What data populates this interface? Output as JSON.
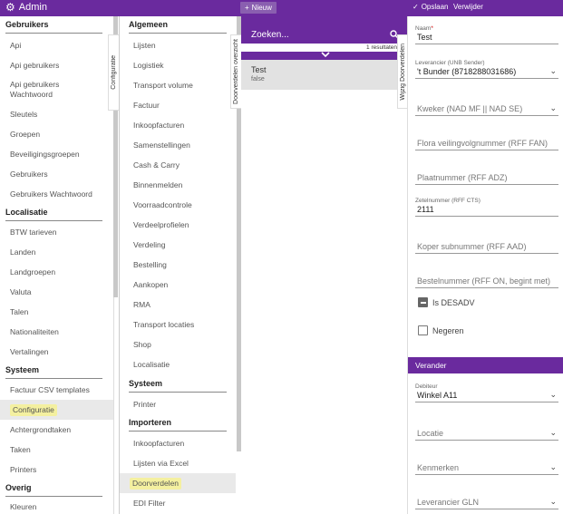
{
  "topbar": {
    "app_title": "Admin",
    "new_label": "Nieuw",
    "save_label": "Opslaan",
    "delete_label": "Verwijder",
    "icons": [
      "gear-icon",
      "plus-icon",
      "check-icon"
    ]
  },
  "nav1": {
    "sections": [
      {
        "title": "Gebruikers",
        "items": [
          "Api",
          "Api gebruikers",
          "Api gebruikers Wachtwoord",
          "Sleutels",
          "Groepen",
          "Beveiligingsgroepen",
          "Gebruikers",
          "Gebruikers Wachtwoord"
        ]
      },
      {
        "title": "Localisatie",
        "items": [
          "BTW tarieven",
          "Landen",
          "Landgroepen",
          "Valuta",
          "Talen",
          "Nationaliteiten",
          "Vertalingen"
        ]
      },
      {
        "title": "Systeem",
        "items": [
          "Factuur CSV templates",
          "Configuratie",
          "Achtergrondtaken",
          "Taken",
          "Printers"
        ]
      },
      {
        "title": "Overig",
        "items": [
          "Kleuren"
        ]
      }
    ],
    "active": "Configuratie"
  },
  "tabs": {
    "configuratie": "Configuratie",
    "doorverdelen_overzicht": "Doorverdelen overzicht",
    "wijzig_doorverdelen": "Wijzig Doorverdelen"
  },
  "nav2": {
    "sections": [
      {
        "title": "Algemeen",
        "items": [
          "Lijsten",
          "Logistiek",
          "Transport volume",
          "Factuur",
          "Inkoopfacturen",
          "Samenstellingen",
          "Cash & Carry",
          "Binnenmelden",
          "Voorraadcontrole",
          "Verdeelprofielen",
          "Verdeling",
          "Bestelling",
          "Aankopen",
          "RMA",
          "Transport locaties",
          "Shop",
          "Localisatie"
        ]
      },
      {
        "title": "Systeem",
        "items": [
          "Printer"
        ]
      },
      {
        "title": "Importeren",
        "items": [
          "Inkoopfacturen",
          "Lijsten via Excel",
          "Doorverdelen",
          "EDI Filter"
        ]
      }
    ],
    "active": "Doorverdelen"
  },
  "list": {
    "search_placeholder": "Zoeken...",
    "result_count": "1 resultaten",
    "rows": [
      {
        "title": "Test",
        "subtitle": "false"
      }
    ]
  },
  "detail": {
    "naam": {
      "label": "Naam",
      "value": "Test"
    },
    "leverancier": {
      "label": "Leverancier (UNB Sender)",
      "value": "'t Bunder (8718288031686)"
    },
    "kweker": {
      "placeholder": "Kweker (NAD MF || NAD SE)"
    },
    "flora": {
      "placeholder": "Flora veilingvolgnummer (RFF FAN)"
    },
    "plaatnummer": {
      "placeholder": "Plaatnummer (RFF ADZ)"
    },
    "zetelnummer": {
      "label": "Zetelnummer (RFF CTS)",
      "value": "2111"
    },
    "koper": {
      "placeholder": "Koper subnummer (RFF AAD)"
    },
    "bestelnummer": {
      "placeholder": "Bestelnummer (RFF ON, begint met)"
    },
    "is_desadv": {
      "label": "Is DESADV",
      "checked": "indeterminate"
    },
    "negeren": {
      "label": "Negeren",
      "checked": false
    },
    "verander_title": "Verander",
    "debiteur": {
      "label": "Debiteur",
      "value": "Winkel A11"
    },
    "locatie": {
      "placeholder": "Locatie"
    },
    "kenmerken": {
      "placeholder": "Kenmerken"
    },
    "leverancier_gln": {
      "placeholder": "Leverancier GLN"
    }
  }
}
